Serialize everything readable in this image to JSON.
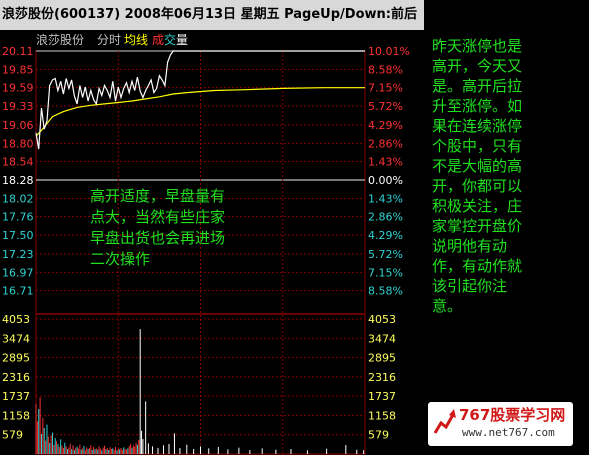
{
  "header": {
    "title": "浪莎股份(600137) 2008年06月13日 星期五 PageUp/Down:前后"
  },
  "legend": {
    "name": "浪莎股份",
    "time_share": "分时",
    "avg_line": "均线",
    "volume_cheng": "成",
    "volume_jiao": "交",
    "volume_liang": "量"
  },
  "price_axis": {
    "prices": [
      "20.11",
      "19.85",
      "19.59",
      "19.33",
      "19.06",
      "18.80",
      "18.54",
      "18.28",
      "18.02",
      "17.76",
      "17.50",
      "17.23",
      "16.97",
      "16.71"
    ],
    "percents": [
      "10.01%",
      "8.58%",
      "7.15%",
      "5.72%",
      "4.29%",
      "2.86%",
      "1.43%",
      "0.00%",
      "1.43%",
      "2.86%",
      "4.29%",
      "5.72%",
      "7.15%",
      "8.58%"
    ],
    "prev_close": 18.28
  },
  "volume_axis": {
    "labels": [
      "4053",
      "3474",
      "2895",
      "2316",
      "1737",
      "1158",
      "579"
    ]
  },
  "colors": {
    "up": "#ff3232",
    "down": "#32d2d2",
    "neutral": "#ffffff",
    "grid": "#8b0000",
    "price_line": "#ffffff",
    "avg_line": "#ffff00",
    "text_green": "#20e020"
  },
  "chart_data": {
    "type": "line",
    "x_unit": "minute index of trading session (0-240)",
    "series": [
      {
        "role": "price",
        "x": [
          0,
          2,
          4,
          6,
          8,
          10,
          12,
          14,
          16,
          18,
          20,
          22,
          24,
          26,
          28,
          30,
          32,
          34,
          36,
          38,
          40,
          42,
          44,
          46,
          48,
          50,
          52,
          54,
          56,
          58,
          60,
          62,
          64,
          66,
          68,
          70,
          72,
          74,
          76,
          78,
          80,
          82,
          84,
          86,
          88,
          90,
          92,
          94,
          96,
          98,
          100,
          102,
          104,
          240
        ],
        "y": [
          18.95,
          18.72,
          19.3,
          19.0,
          19.12,
          19.62,
          19.7,
          19.72,
          19.55,
          19.68,
          19.5,
          19.72,
          19.58,
          19.7,
          19.47,
          19.36,
          19.62,
          19.45,
          19.6,
          19.4,
          19.55,
          19.42,
          19.36,
          19.58,
          19.48,
          19.62,
          19.55,
          19.45,
          19.68,
          19.4,
          19.6,
          19.45,
          19.58,
          19.66,
          19.52,
          19.68,
          19.55,
          19.74,
          19.54,
          19.45,
          19.55,
          19.62,
          19.7,
          19.52,
          19.58,
          19.76,
          19.7,
          19.62,
          19.95,
          20.05,
          20.11,
          20.11,
          20.11,
          20.11
        ]
      },
      {
        "role": "average",
        "x": [
          0,
          6,
          12,
          20,
          30,
          40,
          50,
          60,
          70,
          80,
          90,
          100,
          110,
          130,
          150,
          180,
          210,
          240
        ],
        "y": [
          18.9,
          19.03,
          19.18,
          19.25,
          19.31,
          19.34,
          19.36,
          19.38,
          19.4,
          19.43,
          19.46,
          19.5,
          19.52,
          19.55,
          19.56,
          19.58,
          19.59,
          19.59
        ]
      }
    ],
    "volume": [
      {
        "x": 0,
        "v": 1500,
        "c": "up"
      },
      {
        "x": 1,
        "v": 980,
        "c": "up"
      },
      {
        "x": 2,
        "v": 1350,
        "c": "down"
      },
      {
        "x": 3,
        "v": 1700,
        "c": "up"
      },
      {
        "x": 4,
        "v": 600,
        "c": "down"
      },
      {
        "x": 5,
        "v": 1080,
        "c": "up"
      },
      {
        "x": 6,
        "v": 780,
        "c": "down"
      },
      {
        "x": 7,
        "v": 400,
        "c": "up"
      },
      {
        "x": 8,
        "v": 880,
        "c": "down"
      },
      {
        "x": 9,
        "v": 520,
        "c": "up"
      },
      {
        "x": 10,
        "v": 330,
        "c": "down"
      },
      {
        "x": 11,
        "v": 560,
        "c": "up"
      },
      {
        "x": 12,
        "v": 640,
        "c": "down"
      },
      {
        "x": 13,
        "v": 270,
        "c": "up"
      },
      {
        "x": 14,
        "v": 480,
        "c": "down"
      },
      {
        "x": 15,
        "v": 380,
        "c": "up"
      },
      {
        "x": 16,
        "v": 300,
        "c": "down"
      },
      {
        "x": 17,
        "v": 210,
        "c": "up"
      },
      {
        "x": 18,
        "v": 440,
        "c": "down"
      },
      {
        "x": 19,
        "v": 250,
        "c": "up"
      },
      {
        "x": 20,
        "v": 180,
        "c": "up"
      },
      {
        "x": 21,
        "v": 340,
        "c": "down"
      },
      {
        "x": 22,
        "v": 230,
        "c": "up"
      },
      {
        "x": 23,
        "v": 150,
        "c": "down"
      },
      {
        "x": 24,
        "v": 200,
        "c": "up"
      },
      {
        "x": 25,
        "v": 310,
        "c": "up"
      },
      {
        "x": 26,
        "v": 140,
        "c": "down"
      },
      {
        "x": 27,
        "v": 260,
        "c": "up"
      },
      {
        "x": 28,
        "v": 120,
        "c": "down"
      },
      {
        "x": 29,
        "v": 190,
        "c": "up"
      },
      {
        "x": 30,
        "v": 220,
        "c": "down"
      },
      {
        "x": 31,
        "v": 160,
        "c": "up"
      },
      {
        "x": 32,
        "v": 280,
        "c": "up"
      },
      {
        "x": 33,
        "v": 130,
        "c": "down"
      },
      {
        "x": 34,
        "v": 170,
        "c": "up"
      },
      {
        "x": 35,
        "v": 240,
        "c": "down"
      },
      {
        "x": 36,
        "v": 110,
        "c": "up"
      },
      {
        "x": 37,
        "v": 200,
        "c": "up"
      },
      {
        "x": 38,
        "v": 150,
        "c": "down"
      },
      {
        "x": 39,
        "v": 180,
        "c": "up"
      },
      {
        "x": 40,
        "v": 260,
        "c": "up"
      },
      {
        "x": 41,
        "v": 120,
        "c": "down"
      },
      {
        "x": 42,
        "v": 210,
        "c": "up"
      },
      {
        "x": 43,
        "v": 140,
        "c": "down"
      },
      {
        "x": 44,
        "v": 170,
        "c": "up"
      },
      {
        "x": 45,
        "v": 130,
        "c": "down"
      },
      {
        "x": 46,
        "v": 230,
        "c": "up"
      },
      {
        "x": 47,
        "v": 160,
        "c": "up"
      },
      {
        "x": 48,
        "v": 110,
        "c": "down"
      },
      {
        "x": 49,
        "v": 190,
        "c": "up"
      },
      {
        "x": 50,
        "v": 250,
        "c": "up"
      },
      {
        "x": 51,
        "v": 140,
        "c": "down"
      },
      {
        "x": 52,
        "v": 180,
        "c": "up"
      },
      {
        "x": 53,
        "v": 120,
        "c": "down"
      },
      {
        "x": 54,
        "v": 200,
        "c": "up"
      },
      {
        "x": 55,
        "v": 150,
        "c": "up"
      },
      {
        "x": 56,
        "v": 170,
        "c": "down"
      },
      {
        "x": 57,
        "v": 130,
        "c": "up"
      },
      {
        "x": 58,
        "v": 210,
        "c": "up"
      },
      {
        "x": 59,
        "v": 110,
        "c": "down"
      },
      {
        "x": 60,
        "v": 160,
        "c": "up"
      },
      {
        "x": 61,
        "v": 140,
        "c": "down"
      },
      {
        "x": 62,
        "v": 180,
        "c": "up"
      },
      {
        "x": 63,
        "v": 120,
        "c": "up"
      },
      {
        "x": 64,
        "v": 200,
        "c": "down"
      },
      {
        "x": 65,
        "v": 150,
        "c": "up"
      },
      {
        "x": 66,
        "v": 130,
        "c": "up"
      },
      {
        "x": 67,
        "v": 170,
        "c": "down"
      },
      {
        "x": 68,
        "v": 240,
        "c": "up"
      },
      {
        "x": 69,
        "v": 300,
        "c": "up"
      },
      {
        "x": 70,
        "v": 190,
        "c": "down"
      },
      {
        "x": 71,
        "v": 260,
        "c": "up"
      },
      {
        "x": 72,
        "v": 220,
        "c": "up"
      },
      {
        "x": 73,
        "v": 340,
        "c": "up"
      },
      {
        "x": 74,
        "v": 280,
        "c": "down"
      },
      {
        "x": 75,
        "v": 420,
        "c": "up"
      },
      {
        "x": 76,
        "v": 3750,
        "c": "neutral"
      },
      {
        "x": 77,
        "v": 700,
        "c": "neutral"
      },
      {
        "x": 78,
        "v": 450,
        "c": "neutral"
      },
      {
        "x": 80,
        "v": 1580,
        "c": "neutral"
      },
      {
        "x": 82,
        "v": 320,
        "c": "neutral"
      },
      {
        "x": 85,
        "v": 230,
        "c": "neutral"
      },
      {
        "x": 89,
        "v": 180,
        "c": "neutral"
      },
      {
        "x": 93,
        "v": 260,
        "c": "neutral"
      },
      {
        "x": 97,
        "v": 300,
        "c": "neutral"
      },
      {
        "x": 101,
        "v": 620,
        "c": "neutral"
      },
      {
        "x": 105,
        "v": 180,
        "c": "neutral"
      },
      {
        "x": 110,
        "v": 280,
        "c": "neutral"
      },
      {
        "x": 115,
        "v": 150,
        "c": "neutral"
      },
      {
        "x": 120,
        "v": 230,
        "c": "neutral"
      },
      {
        "x": 126,
        "v": 170,
        "c": "neutral"
      },
      {
        "x": 133,
        "v": 210,
        "c": "neutral"
      },
      {
        "x": 140,
        "v": 140,
        "c": "neutral"
      },
      {
        "x": 148,
        "v": 190,
        "c": "neutral"
      },
      {
        "x": 156,
        "v": 120,
        "c": "neutral"
      },
      {
        "x": 165,
        "v": 170,
        "c": "neutral"
      },
      {
        "x": 175,
        "v": 130,
        "c": "neutral"
      },
      {
        "x": 186,
        "v": 150,
        "c": "neutral"
      },
      {
        "x": 198,
        "v": 110,
        "c": "neutral"
      },
      {
        "x": 212,
        "v": 160,
        "c": "neutral"
      },
      {
        "x": 226,
        "v": 270,
        "c": "neutral"
      },
      {
        "x": 234,
        "v": 130,
        "c": "neutral"
      },
      {
        "x": 239,
        "v": 110,
        "c": "neutral"
      }
    ],
    "ylim": [
      16.45,
      20.11
    ],
    "vol_lim": [
      0,
      4053
    ]
  },
  "annotations": {
    "right_commentary": "昨天涨停也是\n高开，今天又\n是。高开后拉\n升至涨停。如\n果在连续涨停\n个股中，只有\n不是大幅的高\n开，你都可以\n积极关注，庄\n家掌控开盘价\n说明他有动\n作，有动作就\n该引起你注\n意。",
    "chart_note": "高开适度，早盘量有\n点大，当然有些庄家\n早盘出货也会再进场\n二次操作"
  },
  "watermark": {
    "top": "767股票学习网",
    "url": "www.net767.com"
  }
}
